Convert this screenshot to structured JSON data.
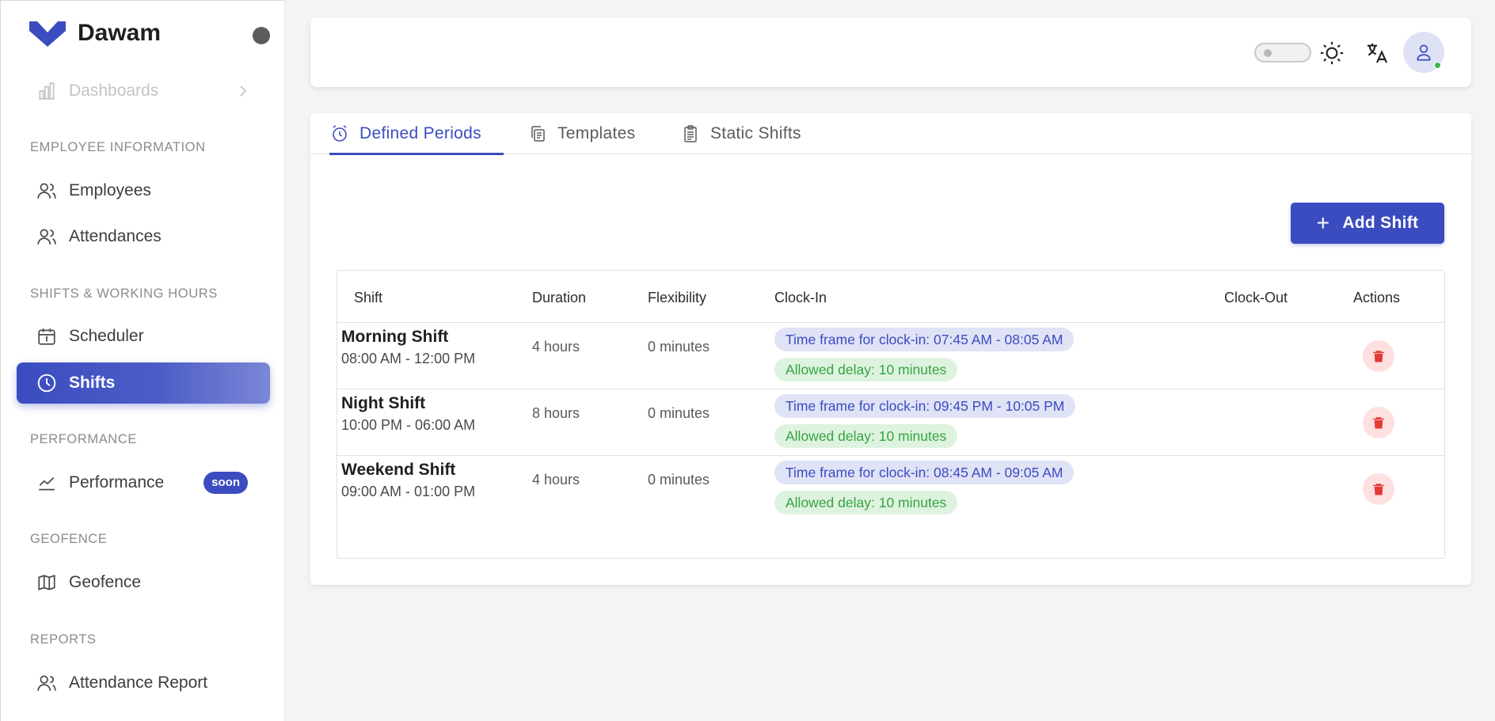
{
  "app": {
    "name": "Dawam"
  },
  "sidebar": {
    "dashboards": "Dashboards",
    "sections": {
      "employee_info": "EMPLOYEE INFORMATION",
      "shifts_hours": "SHIFTS & WORKING HOURS",
      "performance": "PERFORMANCE",
      "geofence": "GEOFENCE",
      "reports": "REPORTS"
    },
    "items": {
      "employees": "Employees",
      "attendances": "Attendances",
      "scheduler": "Scheduler",
      "shifts": "Shifts",
      "performance": "Performance",
      "performance_badge": "soon",
      "geofence": "Geofence",
      "attendance_report": "Attendance Report"
    }
  },
  "tabs": {
    "defined_periods": "Defined Periods",
    "templates": "Templates",
    "static_shifts": "Static Shifts"
  },
  "actions": {
    "add_shift": "Add Shift"
  },
  "table": {
    "headers": {
      "shift": "Shift",
      "duration": "Duration",
      "flexibility": "Flexibility",
      "clock_in": "Clock-In",
      "clock_out": "Clock-Out",
      "actions": "Actions"
    },
    "rows": [
      {
        "name": "Morning Shift",
        "time": "08:00 AM - 12:00 PM",
        "duration": "4 hours",
        "flexibility": "0 minutes",
        "clock_in_window": "Time frame for clock-in: 07:45 AM - 08:05 AM",
        "allowed_delay": "Allowed delay: 10 minutes"
      },
      {
        "name": "Night Shift",
        "time": "10:00 PM - 06:00 AM",
        "duration": "8 hours",
        "flexibility": "0 minutes",
        "clock_in_window": "Time frame for clock-in: 09:45 PM - 10:05 PM",
        "allowed_delay": "Allowed delay: 10 minutes"
      },
      {
        "name": "Weekend Shift",
        "time": "09:00 AM - 01:00 PM",
        "duration": "4 hours",
        "flexibility": "0 minutes",
        "clock_in_window": "Time frame for clock-in: 08:45 AM - 09:05 AM",
        "allowed_delay": "Allowed delay: 10 minutes"
      }
    ]
  },
  "colors": {
    "accent": "#3b4cc0",
    "success": "#35a442",
    "danger": "#e53935"
  },
  "icons": {
    "logo": "dawam-logo",
    "theme": "sun-icon",
    "language": "translate-icon",
    "user": "user-icon",
    "delete": "trash-icon"
  }
}
